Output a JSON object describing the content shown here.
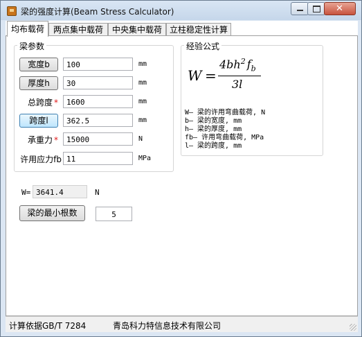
{
  "window": {
    "title": "梁的强度计算(Beam Stress Calculator)",
    "close_glyph": "✕"
  },
  "tabs": [
    {
      "label": "均布载荷"
    },
    {
      "label": "两点集中载荷"
    },
    {
      "label": "中央集中载荷"
    },
    {
      "label": "立柱稳定性计算"
    }
  ],
  "params": {
    "group_title": "梁参数",
    "rows": [
      {
        "label": "宽度b",
        "value": "100",
        "unit": "mm"
      },
      {
        "label": "厚度h",
        "value": "30",
        "unit": "mm"
      },
      {
        "label": "总跨度",
        "value": "1600",
        "unit": "mm"
      },
      {
        "label": "跨度l",
        "value": "362.5",
        "unit": "mm"
      },
      {
        "label": "承重力",
        "value": "15000",
        "unit": "N"
      },
      {
        "label": "许用应力fb",
        "value": "11",
        "unit": "MPa"
      }
    ],
    "required_mark": "*"
  },
  "formula": {
    "group_title": "经验公式",
    "lhs": "W",
    "eq": "=",
    "num_a": "4bh",
    "num_exp": "2",
    "num_f": "f",
    "num_sub": "b",
    "den": "3l",
    "legend": [
      "W— 梁的许用弯曲载荷, N",
      "b— 梁的宽度, mm",
      "h— 梁的厚度, mm",
      "fb— 许用弯曲载荷, MPa",
      "l— 梁的跨度, mm"
    ]
  },
  "result": {
    "label": "W=",
    "value": "3641.4",
    "unit": "N"
  },
  "min_beams": {
    "button_label": "梁的最小根数",
    "value": "5"
  },
  "status": {
    "basis": "计算依据GB/T 7284",
    "company": "青岛科力特信息技术有限公司"
  }
}
